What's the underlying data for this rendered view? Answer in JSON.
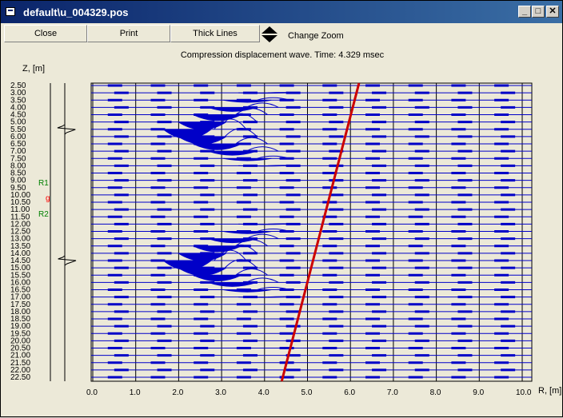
{
  "window": {
    "title": "default\\u_004329.pos"
  },
  "titlebar_buttons": {
    "minimize": "_",
    "maximize": "□",
    "close": "✕"
  },
  "toolbar": {
    "close_label": "Close",
    "print_label": "Print",
    "thick_lines_label": "Thick Lines",
    "change_zoom_label": "Change Zoom"
  },
  "plot": {
    "title": "Compression displacement wave. Time: 4.329 msec",
    "ylabel": "Z, [m]",
    "xlabel": "R, [m]",
    "receiver_labels": [
      {
        "text": "R1",
        "color": "#008000"
      },
      {
        "text": "g",
        "color": "#ff0000"
      },
      {
        "text": "R2",
        "color": "#008000"
      }
    ]
  },
  "chart_data": {
    "type": "line",
    "x_ticks": [
      "0.0",
      "1.0",
      "2.0",
      "3.0",
      "4.0",
      "5.0",
      "6.0",
      "7.0",
      "8.0",
      "9.0",
      "10.0"
    ],
    "y_ticks": [
      "2.50",
      "3.00",
      "3.50",
      "4.00",
      "4.50",
      "5.00",
      "5.50",
      "6.00",
      "6.50",
      "7.00",
      "7.50",
      "8.00",
      "8.50",
      "9.00",
      "9.50",
      "10.00",
      "10.50",
      "11.00",
      "11.50",
      "12.00",
      "12.50",
      "13.00",
      "13.50",
      "14.00",
      "14.50",
      "15.00",
      "15.50",
      "16.00",
      "16.50",
      "17.00",
      "17.50",
      "18.00",
      "18.50",
      "19.00",
      "19.50",
      "20.00",
      "20.50",
      "21.00",
      "21.50",
      "22.00",
      "22.50"
    ],
    "xlim": [
      0,
      10.3
    ],
    "ylim": [
      2.5,
      22.5
    ],
    "grid": true,
    "trace_color": "#0000c8",
    "red_line": {
      "color": "#cc0000",
      "points": [
        [
          6.2,
          2.5
        ],
        [
          4.4,
          22.5
        ]
      ]
    },
    "source_depths": [
      5.5,
      14.5
    ]
  }
}
